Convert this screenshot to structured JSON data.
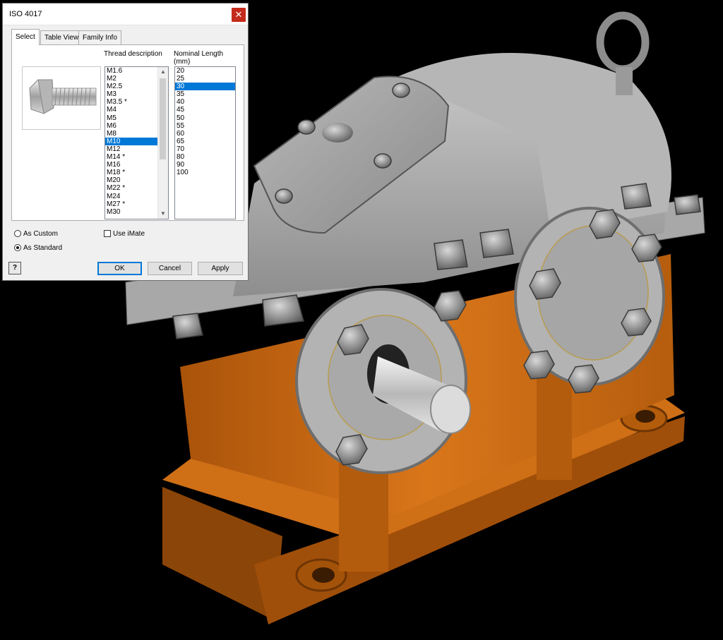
{
  "dialog": {
    "title": "ISO 4017",
    "close_glyph": "✕",
    "tabs": [
      {
        "label": "Select",
        "active": true
      },
      {
        "label": "Table View",
        "active": false
      },
      {
        "label": "Family Info",
        "active": false
      }
    ],
    "thread_description": {
      "label": "Thread description",
      "items": [
        "M1.6",
        "M2",
        "M2.5",
        "M3",
        "M3.5 *",
        "M4",
        "M5",
        "M6",
        "M8",
        "M10",
        "M12",
        "M14 *",
        "M16",
        "M18 *",
        "M20",
        "M22 *",
        "M24",
        "M27 *",
        "M30"
      ],
      "selected": "M10"
    },
    "nominal_length": {
      "label_line1": "Nominal Length",
      "label_line2": "(mm)",
      "items": [
        "20",
        "25",
        "30",
        "35",
        "40",
        "45",
        "50",
        "55",
        "60",
        "65",
        "70",
        "80",
        "90",
        "100"
      ],
      "selected": "30"
    },
    "radio_as_custom": "As Custom",
    "radio_as_standard": "As Standard",
    "radio_selected": "As Standard",
    "checkbox_use_imate": "Use iMate",
    "checkbox_use_imate_checked": false,
    "help_glyph": "?",
    "buttons": {
      "ok": "OK",
      "cancel": "Cancel",
      "apply": "Apply"
    }
  },
  "colors": {
    "selection": "#0078d7",
    "gearbox_base": "#c8680f",
    "gearbox_housing": "#9a9a9a"
  },
  "icons": [
    "bolt-preview-icon",
    "close-icon",
    "help-icon",
    "scroll-up-icon",
    "scroll-down-icon"
  ]
}
